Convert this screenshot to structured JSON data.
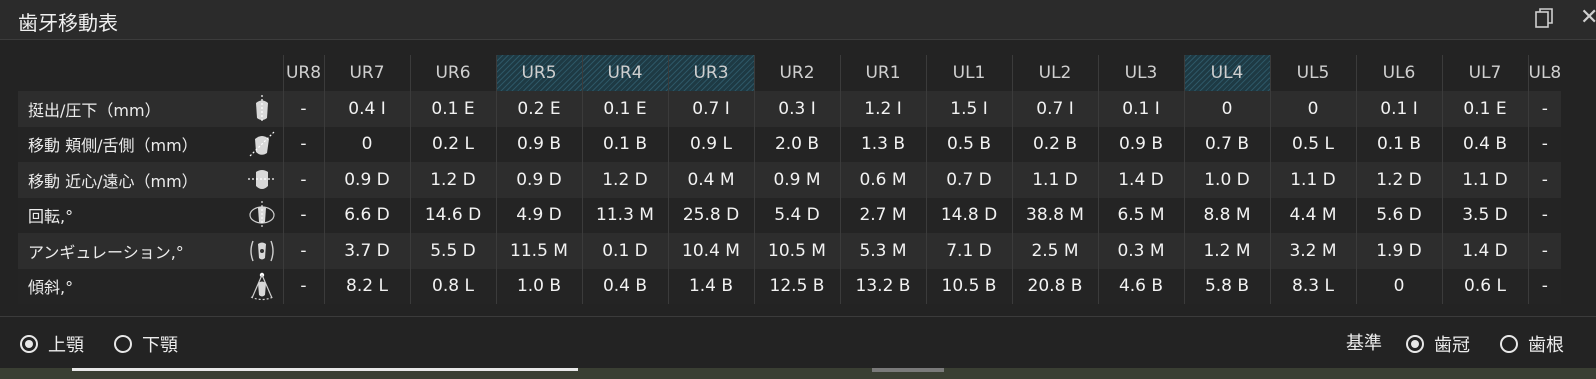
{
  "window": {
    "title": "歯牙移動表"
  },
  "icons": {
    "copy": "copy-icon",
    "close": "close-icon"
  },
  "table": {
    "columns": [
      "UR8",
      "UR7",
      "UR6",
      "UR5",
      "UR4",
      "UR3",
      "UR2",
      "UR1",
      "UL1",
      "UL2",
      "UL3",
      "UL4",
      "UL5",
      "UL6",
      "UL7",
      "UL8"
    ],
    "highlighted_columns": [
      "UR5",
      "UR4",
      "UR3",
      "UL4"
    ],
    "rows": [
      {
        "label": "挺出/圧下（mm）",
        "icon": "extrusion-intrusion-icon",
        "values": [
          "-",
          "0.4 I",
          "0.1 E",
          "0.2 E",
          "0.1 E",
          "0.7 I",
          "0.3 I",
          "1.2 I",
          "1.5 I",
          "0.7 I",
          "0.1 I",
          "0",
          "0",
          "0.1 I",
          "0.1 E",
          "-"
        ]
      },
      {
        "label": "移動 頬側/舌側（mm）",
        "icon": "buccal-lingual-icon",
        "values": [
          "-",
          "0",
          "0.2 L",
          "0.9 B",
          "0.1 B",
          "0.9 L",
          "2.0 B",
          "1.3 B",
          "0.5 B",
          "0.2 B",
          "0.9 B",
          "0.7 B",
          "0.5 L",
          "0.1 B",
          "0.4 B",
          "-"
        ]
      },
      {
        "label": "移動 近心/遠心（mm）",
        "icon": "mesial-distal-icon",
        "values": [
          "-",
          "0.9 D",
          "1.2 D",
          "0.9 D",
          "1.2 D",
          "0.4 M",
          "0.9 M",
          "0.6 M",
          "0.7 D",
          "1.1 D",
          "1.4 D",
          "1.0 D",
          "1.1 D",
          "1.2 D",
          "1.1 D",
          "-"
        ]
      },
      {
        "label": "回転,°",
        "icon": "rotation-icon",
        "values": [
          "-",
          "6.6 D",
          "14.6 D",
          "4.9 D",
          "11.3 M",
          "25.8 D",
          "5.4 D",
          "2.7 M",
          "14.8 D",
          "38.8 M",
          "6.5 M",
          "8.8 M",
          "4.4 M",
          "5.6 D",
          "3.5 D",
          "-"
        ]
      },
      {
        "label": "アンギュレーション,°",
        "icon": "angulation-icon",
        "values": [
          "-",
          "3.7 D",
          "5.5 D",
          "11.5 M",
          "0.1 D",
          "10.4 M",
          "10.5 M",
          "5.3 M",
          "7.1 D",
          "2.5 M",
          "0.3 M",
          "1.2 M",
          "3.2 M",
          "1.9 D",
          "1.4 D",
          "-"
        ]
      },
      {
        "label": "傾斜,°",
        "icon": "inclination-icon",
        "values": [
          "-",
          "8.2 L",
          "0.8 L",
          "1.0 B",
          "0.4 B",
          "1.4 B",
          "12.5 B",
          "13.2 B",
          "10.5 B",
          "20.8 B",
          "4.6 B",
          "5.8 B",
          "8.3 L",
          "0",
          "0.6 L",
          "-"
        ]
      }
    ]
  },
  "jaw": {
    "options": [
      "上顎",
      "下顎"
    ],
    "selected": "上顎"
  },
  "basis": {
    "label": "基準",
    "options": [
      "歯冠",
      "歯根"
    ],
    "selected": "歯冠"
  }
}
